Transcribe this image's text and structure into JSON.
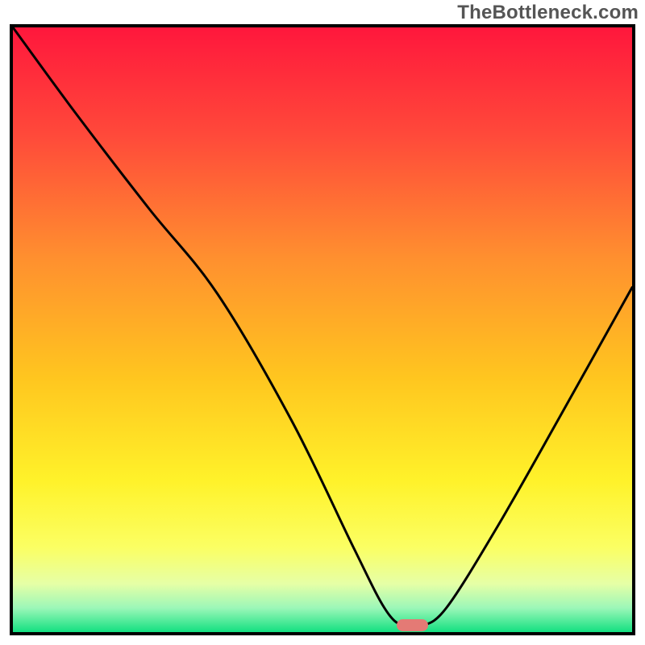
{
  "watermark": "TheBottleneck.com",
  "colors": {
    "gradient_stops": [
      {
        "offset": "0%",
        "color": "#ff173c"
      },
      {
        "offset": "18%",
        "color": "#ff4a3a"
      },
      {
        "offset": "38%",
        "color": "#ff8f2f"
      },
      {
        "offset": "58%",
        "color": "#ffc61f"
      },
      {
        "offset": "75%",
        "color": "#fff22a"
      },
      {
        "offset": "86%",
        "color": "#fbff63"
      },
      {
        "offset": "92%",
        "color": "#e6ffa6"
      },
      {
        "offset": "96%",
        "color": "#9cf7b8"
      },
      {
        "offset": "100%",
        "color": "#13e081"
      }
    ],
    "curve_stroke": "#000000",
    "frame_stroke": "#000000",
    "marker_fill": "#e47a75"
  },
  "chart_data": {
    "type": "line",
    "title": "",
    "xlabel": "",
    "ylabel": "",
    "x_range": [
      0,
      100
    ],
    "y_range": [
      0,
      100
    ],
    "note": "x and y are percentages of the inner plot width/height; y=0 is bottom (best / green), y=100 is top (worst / red). Curve is the black bottleneck line.",
    "series": [
      {
        "name": "bottleneck_curve",
        "x": [
          0,
          10,
          22,
          33,
          45,
          55,
          60,
          63,
          66,
          70,
          78,
          88,
          100
        ],
        "y": [
          100,
          86,
          70,
          56,
          35,
          14,
          4,
          1,
          1,
          4,
          17,
          35,
          57
        ]
      }
    ],
    "optimal_marker": {
      "x": 64.5,
      "y": 1.2,
      "width_pct": 5.0,
      "height_pct": 2.0
    }
  }
}
